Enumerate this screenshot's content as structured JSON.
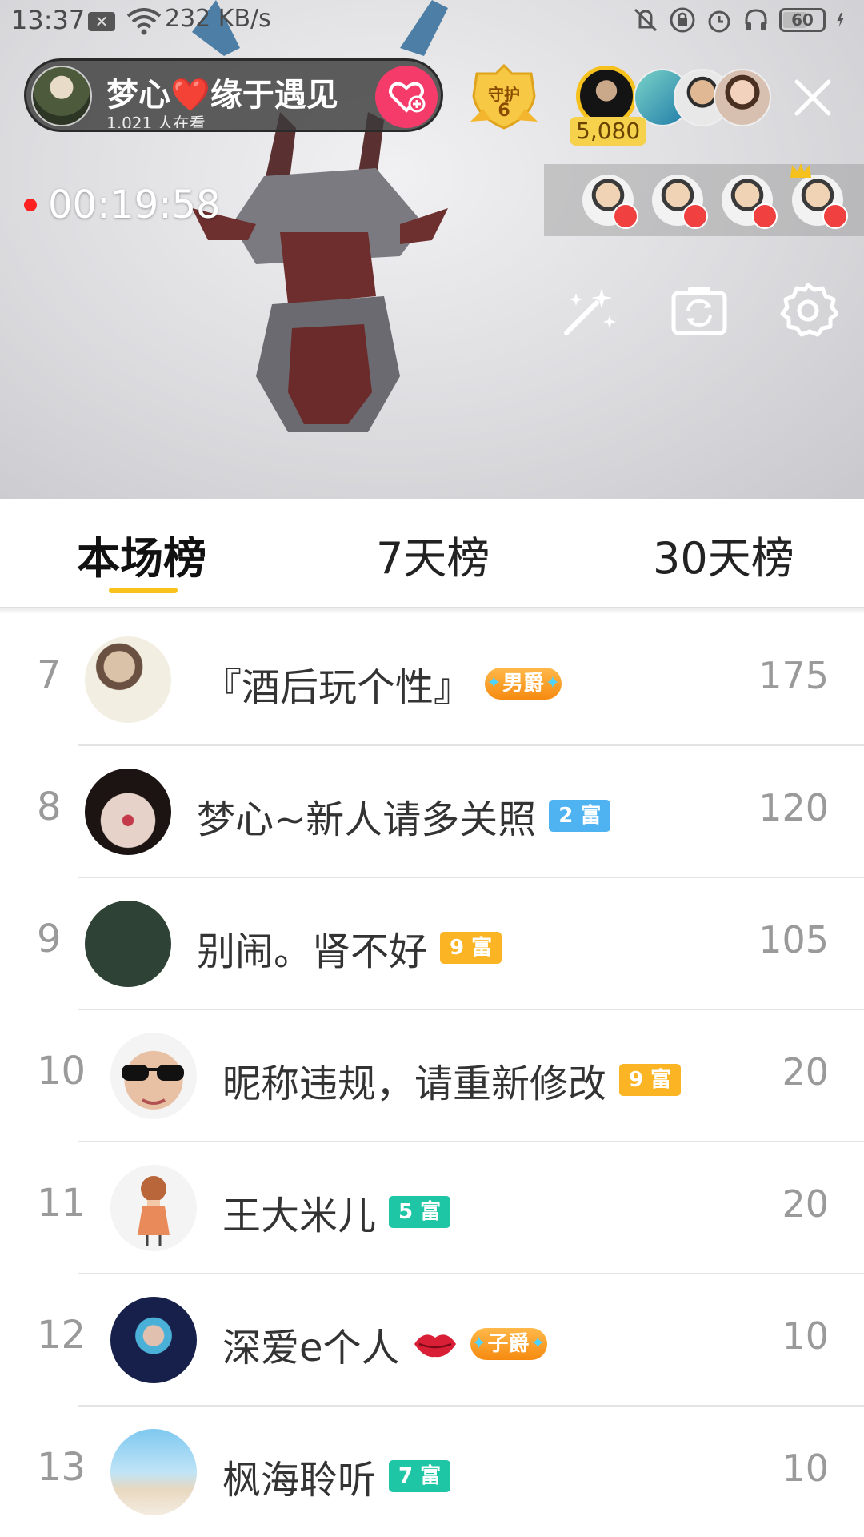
{
  "status_bar": {
    "time": "13:37",
    "speed": "232 KB/s",
    "battery": "60",
    "battery_level_percent": 60,
    "icons": [
      "notification-icon",
      "wifi-icon",
      "mute-icon",
      "lock-icon",
      "alarm-icon",
      "headphones-icon",
      "battery-icon",
      "charging-icon"
    ]
  },
  "live": {
    "anchor_name": "梦心❤️缘于遇见",
    "viewer_count": "1,021 人在看",
    "guard_label": "守护",
    "guard_count": "6",
    "coins": "5,080",
    "elapsed": "00:19:58",
    "tool_icons": [
      "magic-wand-icon",
      "camera-switch-icon",
      "settings-icon"
    ]
  },
  "tabs": [
    {
      "label": "本场榜",
      "active": true
    },
    {
      "label": "7天榜",
      "active": false
    },
    {
      "label": "30天榜",
      "active": false
    }
  ],
  "ranking": [
    {
      "rank": "7",
      "name": "『酒后玩个性』",
      "badge": "男爵",
      "badge_type": "noble",
      "score": "175"
    },
    {
      "rank": "8",
      "name": "梦心~新人请多关照",
      "badge": "2 富",
      "badge_type": "blue",
      "score": "120"
    },
    {
      "rank": "9",
      "name": "别闹。肾不好",
      "badge": "9 富",
      "badge_type": "gold",
      "score": "105"
    },
    {
      "rank": "10",
      "name": "昵称违规，请重新修改",
      "badge": "9 富",
      "badge_type": "gold",
      "score": "20"
    },
    {
      "rank": "11",
      "name": "王大米儿",
      "badge": "5 富",
      "badge_type": "teal",
      "score": "20"
    },
    {
      "rank": "12",
      "name": "深爱e个人",
      "badge": "子爵",
      "badge_type": "noble",
      "score": "10"
    },
    {
      "rank": "13",
      "name": "枫海聆听",
      "badge": "7 富",
      "badge_type": "teal",
      "score": "10"
    }
  ],
  "colors": {
    "accent": "#f7c21b",
    "follow": "#f53b6a",
    "rich_blue": "#4fb3f2",
    "rich_gold": "#fbb424",
    "rich_teal": "#1fc6a6",
    "recording": "#ff2020"
  }
}
